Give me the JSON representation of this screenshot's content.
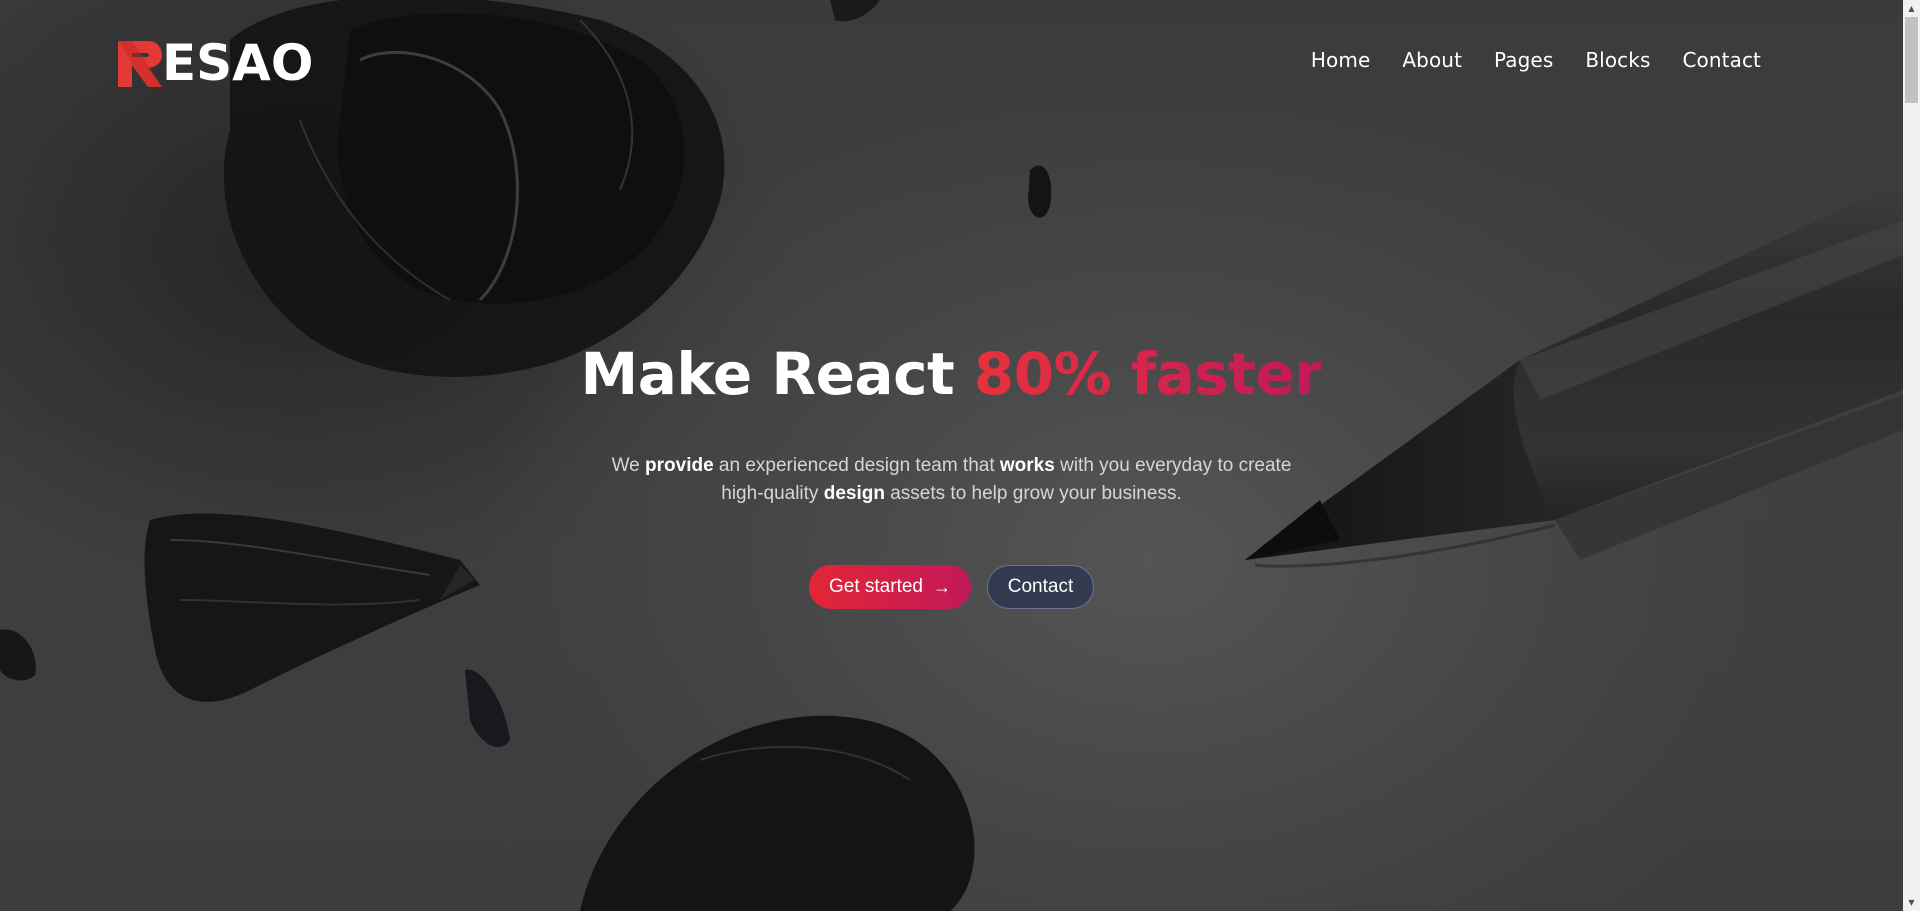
{
  "brand": {
    "logo_text": "ESAO",
    "logo_letter": "R",
    "logo_color": "#e53935"
  },
  "nav": {
    "items": [
      "Home",
      "About",
      "Pages",
      "Blocks",
      "Contact"
    ]
  },
  "hero": {
    "headline_main": "Make React ",
    "headline_accent": "80% faster",
    "subtitle_parts": [
      {
        "text": "We ",
        "bold": false
      },
      {
        "text": "provide",
        "bold": true
      },
      {
        "text": " an experienced design team that ",
        "bold": false
      },
      {
        "text": "works",
        "bold": true
      },
      {
        "text": " with you everyday to create",
        "bold": false
      },
      {
        "text": "high-quality ",
        "bold": false
      },
      {
        "text": "design",
        "bold": true
      },
      {
        "text": " assets to help grow your business.",
        "bold": false
      }
    ],
    "primary_button": "Get started",
    "primary_button_icon": "arrow-right-icon",
    "secondary_button": "Contact"
  },
  "colors": {
    "accent_start": "#e32636",
    "accent_end": "#c2185b",
    "secondary_button_bg": "#2d3750"
  },
  "scrollbar": {
    "position_fraction": 0
  }
}
